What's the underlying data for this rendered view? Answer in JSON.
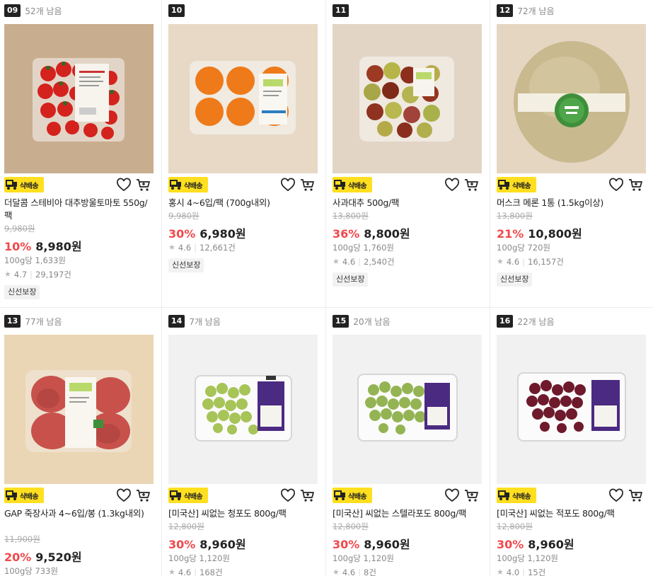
{
  "shipping_label": "샥배송",
  "accent_discount_color": "#f2484b",
  "badge_color": "#ffdf1f",
  "products": [
    {
      "rank": "09",
      "stock": "52개 남음",
      "name": "더달콤 스테비아 대추방울토마토 550g/팩",
      "orig": "9,980원",
      "disc": "10%",
      "price": "8,980원",
      "unit": "100g당 1,633원",
      "rating": "4.7",
      "reviews": "29,197건",
      "tag": "신선보장",
      "image": "cherry-tomato-pack"
    },
    {
      "rank": "10",
      "stock": "",
      "name": "홍시 4~6입/팩 (700g내외)",
      "orig": "9,980원",
      "disc": "30%",
      "price": "6,980원",
      "unit": "",
      "rating": "4.6",
      "reviews": "12,661건",
      "tag": "신선보장",
      "image": "persimmon-pack"
    },
    {
      "rank": "11",
      "stock": "",
      "name": "사과대추 500g/팩",
      "orig": "13,800원",
      "disc": "36%",
      "price": "8,800원",
      "unit": "100g당 1,760원",
      "rating": "4.6",
      "reviews": "2,540건",
      "tag": "신선보장",
      "image": "jujube-pack"
    },
    {
      "rank": "12",
      "stock": "72개 남음",
      "name": "머스크 메론 1통 (1.5kg이상)",
      "orig": "13,800원",
      "disc": "21%",
      "price": "10,800원",
      "unit": "100g당 720원",
      "rating": "4.6",
      "reviews": "16,157건",
      "tag": "신선보장",
      "image": "musk-melon"
    },
    {
      "rank": "13",
      "stock": "77개 남음",
      "name": "GAP 죽장사과 4~6입/봉 (1.3kg내외)",
      "orig": "11,900원",
      "disc": "20%",
      "price": "9,520원",
      "unit": "100g당 733원",
      "rating": "",
      "reviews": "",
      "tag": "",
      "image": "apple-bag"
    },
    {
      "rank": "14",
      "stock": "7개 남음",
      "name": "[미국산] 씨없는 청포도 800g/팩",
      "orig": "12,800원",
      "disc": "30%",
      "price": "8,960원",
      "unit": "100g당 1,120원",
      "rating": "4.6",
      "reviews": "168건",
      "tag": "",
      "image": "green-grape-pack"
    },
    {
      "rank": "15",
      "stock": "20개 남음",
      "name": "[미국산] 씨없는 스텔라포도 800g/팩",
      "orig": "12,800원",
      "disc": "30%",
      "price": "8,960원",
      "unit": "100g당 1,120원",
      "rating": "4.6",
      "reviews": "8건",
      "tag": "",
      "image": "stella-grape-pack"
    },
    {
      "rank": "16",
      "stock": "22개 남음",
      "name": "[미국산] 씨없는 적포도 800g/팩",
      "orig": "12,800원",
      "disc": "30%",
      "price": "8,960원",
      "unit": "100g당 1,120원",
      "rating": "4.0",
      "reviews": "15건",
      "tag": "",
      "image": "red-grape-pack"
    }
  ]
}
